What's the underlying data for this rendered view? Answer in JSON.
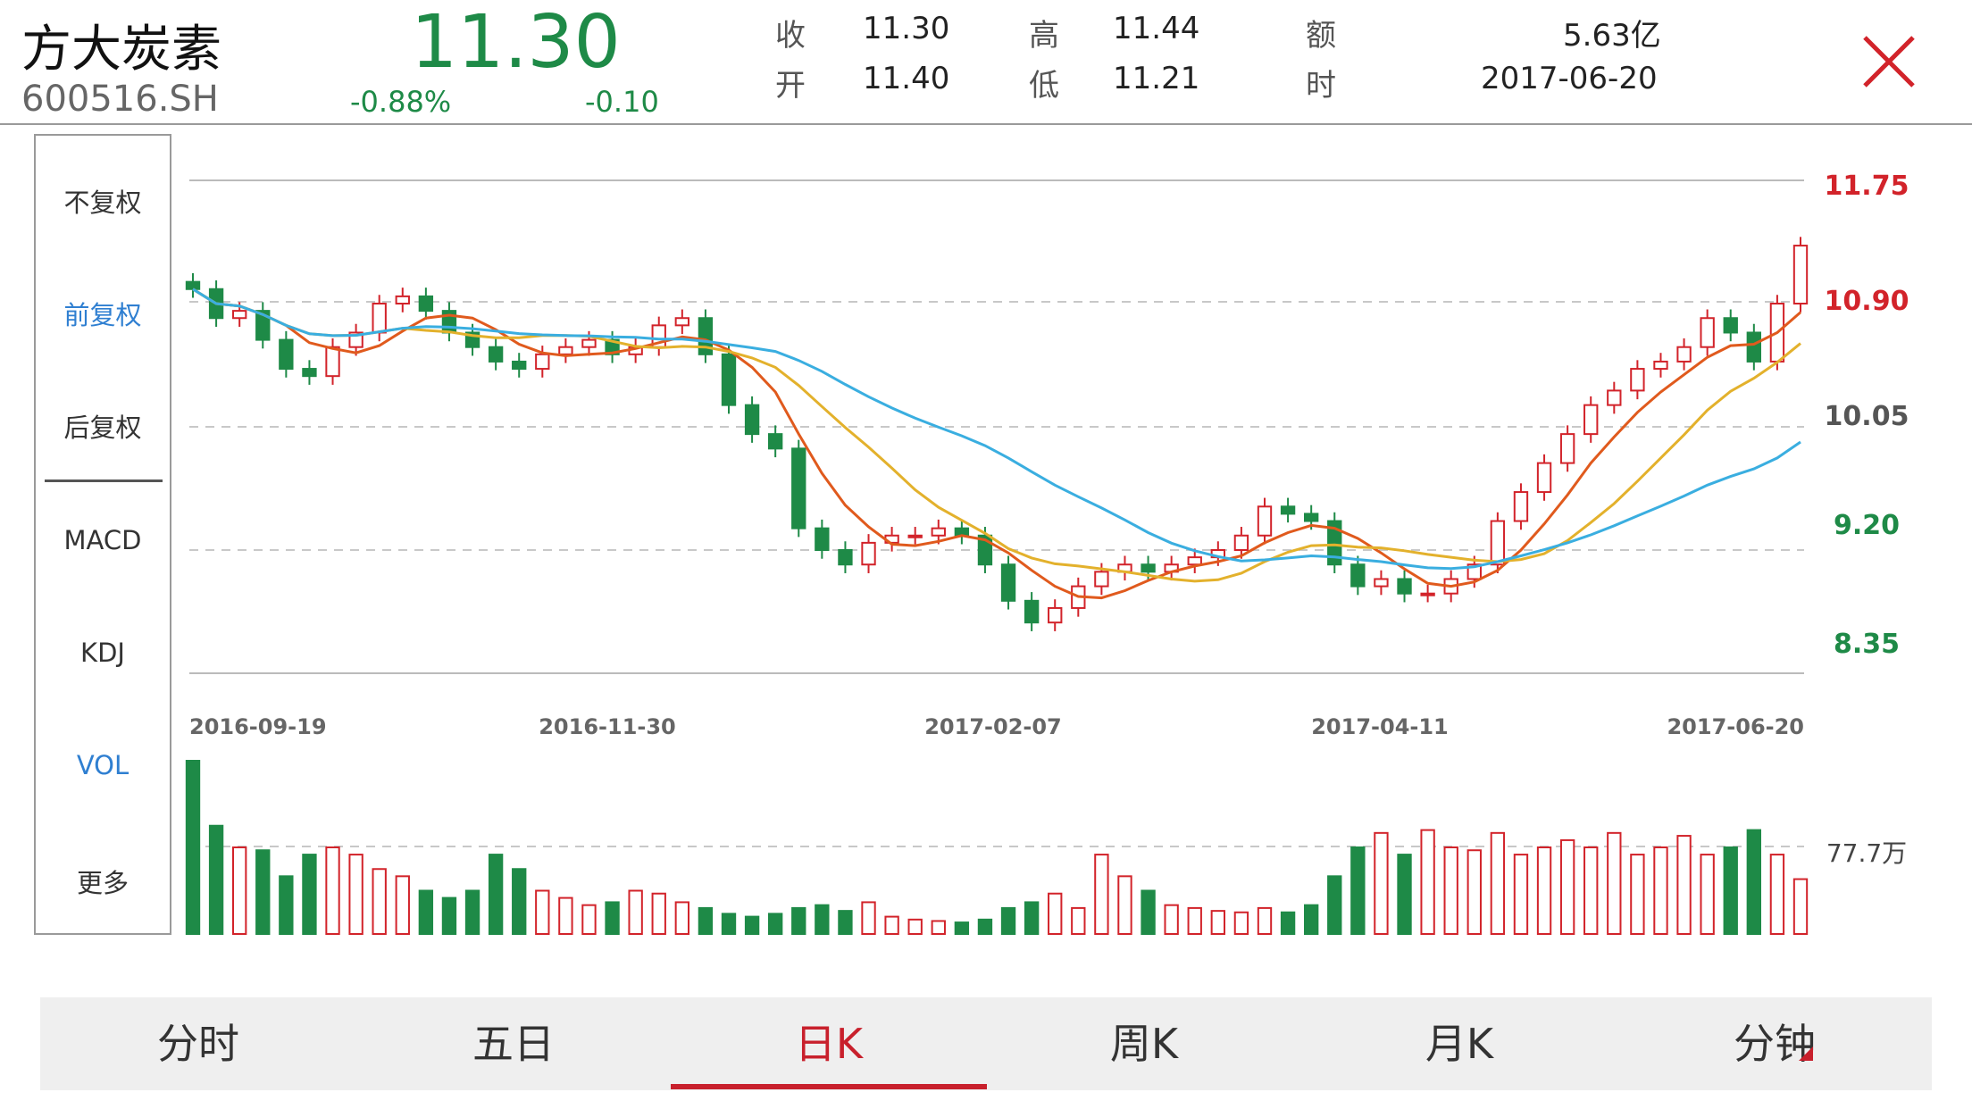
{
  "header": {
    "name": "方大炭素",
    "code": "600516.SH",
    "price": "11.30",
    "change_pct": "-0.88%",
    "change": "-0.10",
    "quote": {
      "close_label": "收",
      "close": "11.30",
      "open_label": "开",
      "open": "11.40",
      "high_label": "高",
      "high": "11.44",
      "low_label": "低",
      "low": "11.21",
      "amount_label": "额",
      "amount": "5.63亿",
      "time_label": "时",
      "time": "2017-06-20"
    }
  },
  "colors": {
    "up": "#d2232a",
    "down": "#1e8a47",
    "ma5": "#e05a1d",
    "ma10": "#e3b12c",
    "ma20": "#3aaee0",
    "accent": "#c8202c",
    "menu_active": "#2f7fd1"
  },
  "side_menu": {
    "items": [
      {
        "label": "不复权",
        "active": false
      },
      {
        "label": "前复权",
        "active": true
      },
      {
        "label": "后复权",
        "active": false
      },
      {
        "label": "MACD",
        "active": false
      },
      {
        "label": "KDJ",
        "active": false
      },
      {
        "label": "VOL",
        "active": true
      },
      {
        "label": "更多",
        "active": false
      }
    ]
  },
  "chart": {
    "price_axis": [
      "11.75",
      "10.90",
      "10.05",
      "9.20",
      "8.35"
    ],
    "date_axis": [
      "2016-09-19",
      "2016-11-30",
      "2017-02-07",
      "2017-04-11",
      "2017-06-20"
    ],
    "volume_label": "77.7万"
  },
  "chart_data": {
    "type": "candlestick",
    "x_range": [
      "2016-09-19",
      "2017-06-20"
    ],
    "ylim": [
      8.35,
      11.75
    ],
    "series": [
      {
        "name": "close",
        "values": [
          11.0,
          10.8,
          10.85,
          10.65,
          10.45,
          10.4,
          10.6,
          10.7,
          10.9,
          10.95,
          10.85,
          10.7,
          10.6,
          10.5,
          10.45,
          10.55,
          10.6,
          10.65,
          10.55,
          10.6,
          10.75,
          10.8,
          10.55,
          10.2,
          10.0,
          9.9,
          9.35,
          9.2,
          9.1,
          9.25,
          9.3,
          9.3,
          9.35,
          9.3,
          9.1,
          8.85,
          8.7,
          8.8,
          8.95,
          9.05,
          9.1,
          9.05,
          9.1,
          9.15,
          9.2,
          9.3,
          9.5,
          9.45,
          9.4,
          9.1,
          8.95,
          9.0,
          8.9,
          8.9,
          9.0,
          9.1,
          9.4,
          9.6,
          9.8,
          10.0,
          10.2,
          10.3,
          10.45,
          10.5,
          10.6,
          10.8,
          10.7,
          10.5,
          10.9,
          11.3
        ]
      },
      {
        "name": "volume",
        "values": [
          120,
          75,
          60,
          58,
          40,
          55,
          60,
          55,
          45,
          40,
          30,
          25,
          30,
          55,
          45,
          30,
          25,
          20,
          22,
          30,
          28,
          22,
          18,
          14,
          12,
          14,
          18,
          20,
          16,
          22,
          12,
          10,
          9,
          8,
          10,
          18,
          22,
          28,
          18,
          55,
          40,
          30,
          20,
          18,
          16,
          15,
          18,
          15,
          20,
          40,
          60,
          70,
          55,
          72,
          60,
          58,
          70,
          55,
          60,
          65,
          60,
          70,
          55,
          60,
          68,
          55,
          60,
          72,
          55,
          38
        ]
      }
    ],
    "volume_label": "77.7万"
  },
  "tabs": [
    {
      "label": "分时",
      "active": false
    },
    {
      "label": "五日",
      "active": false
    },
    {
      "label": "日K",
      "active": true
    },
    {
      "label": "周K",
      "active": false
    },
    {
      "label": "月K",
      "active": false
    },
    {
      "label": "分钟",
      "active": false
    }
  ]
}
